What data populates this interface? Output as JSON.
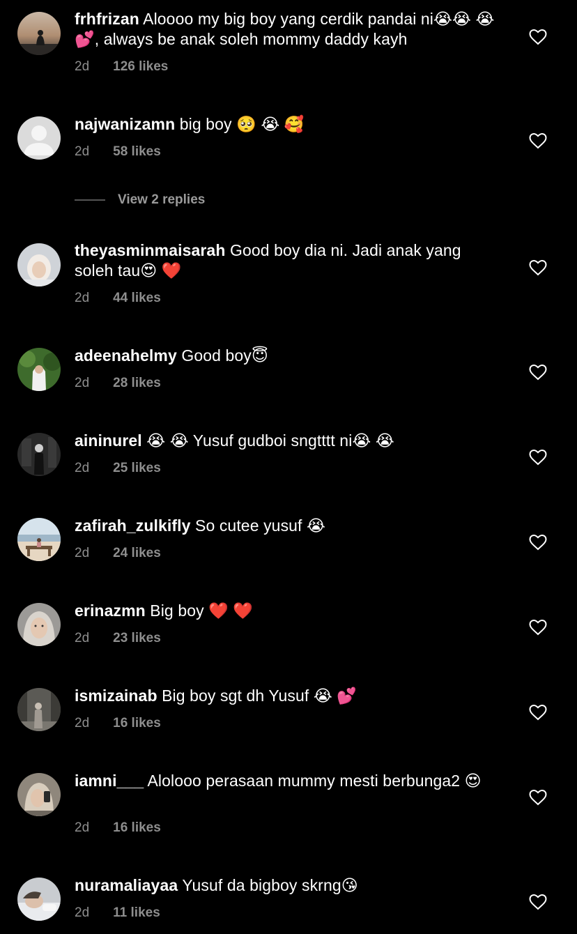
{
  "comments": [
    {
      "username": "frhfrizan",
      "text": "Aloooo my big boy yang cerdik pandai ni😭😭 😭 💕, always be anak soleh mommy daddy kayh",
      "time": "2d",
      "likes": "126 likes",
      "avatar": "sunset-silhouette"
    },
    {
      "username": "najwanizamn",
      "text": "big boy 🥺 😭 🥰",
      "time": "2d",
      "likes": "58 likes",
      "avatar": "default-person"
    },
    {
      "username": "theyasminmaisarah",
      "text": "Good boy dia ni. Jadi anak yang soleh tau😍 ❤️",
      "time": "2d",
      "likes": "44 likes",
      "avatar": "woman-white-hijab"
    },
    {
      "username": "adeenahelmy",
      "text": "Good boy😇",
      "time": "2d",
      "likes": "28 likes",
      "avatar": "woman-green-background"
    },
    {
      "username": "aininurel",
      "text": "😭 😭  Yusuf gudboi sngtttt ni😭 😭",
      "time": "2d",
      "likes": "25 likes",
      "avatar": "person-dark-room"
    },
    {
      "username": "zafirah_zulkifly",
      "text": "So cutee yusuf 😭",
      "time": "2d",
      "likes": "24 likes",
      "avatar": "beach-bench"
    },
    {
      "username": "erinazmn",
      "text": "Big boy ❤️ ❤️",
      "time": "2d",
      "likes": "23 likes",
      "avatar": "woman-selfie"
    },
    {
      "username": "ismizainab",
      "text": "Big boy sgt dh Yusuf 😭 💕",
      "time": "2d",
      "likes": "16 likes",
      "avatar": "woman-street"
    },
    {
      "username": "iamni___",
      "text": "Alolooo perasaan mummy mesti berbunga2 😍",
      "time": "2d",
      "likes": "16 likes",
      "avatar": "woman-phone-mirror"
    },
    {
      "username": "nuramaliayaa",
      "text": "Yusuf da bigboy skrng😘",
      "time": "2d",
      "likes": "11 likes",
      "avatar": "woman-lying"
    }
  ],
  "view_replies": "View 2 replies",
  "icons": {
    "like": "heart-outline-icon"
  },
  "colors": {
    "background": "#000000",
    "text": "#ffffff",
    "meta": "#8e8e8e"
  }
}
